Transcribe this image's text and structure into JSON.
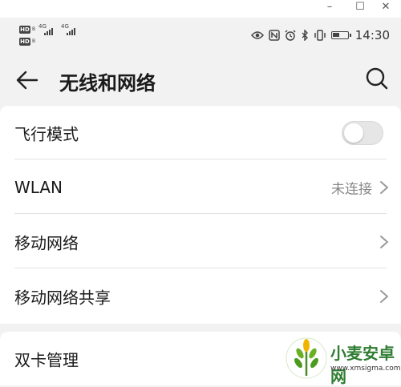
{
  "window_controls": {
    "minimize": "–",
    "maximize": "☐",
    "close": "✕"
  },
  "status_bar": {
    "sim1": {
      "hd": "HD",
      "sub": "B",
      "network": "4G"
    },
    "sim2": {
      "hd": "HD",
      "sub": "B",
      "network": "4G"
    },
    "icons": [
      "eye-icon",
      "nfc-icon",
      "alarm-icon",
      "bluetooth-icon",
      "vibrate-icon",
      "battery-icon"
    ],
    "time": "14:30"
  },
  "header": {
    "title": "无线和网络",
    "back_icon": "back-arrow-icon",
    "search_icon": "search-icon"
  },
  "settings": {
    "items": [
      {
        "label": "飞行模式",
        "type": "toggle",
        "on": false
      },
      {
        "label": "WLAN",
        "value": "未连接",
        "type": "link"
      },
      {
        "label": "移动网络",
        "type": "link"
      },
      {
        "label": "移动网络共享",
        "type": "link"
      }
    ],
    "section2": [
      {
        "label": "双卡管理"
      }
    ]
  },
  "watermark": {
    "name": "小麦安卓网",
    "url": "www.xmsigma.com"
  },
  "colors": {
    "background": "#f2f2f2",
    "card": "#ffffff",
    "text": "#1a1a1a",
    "secondary": "#888888",
    "watermark": "#2f7d32"
  }
}
